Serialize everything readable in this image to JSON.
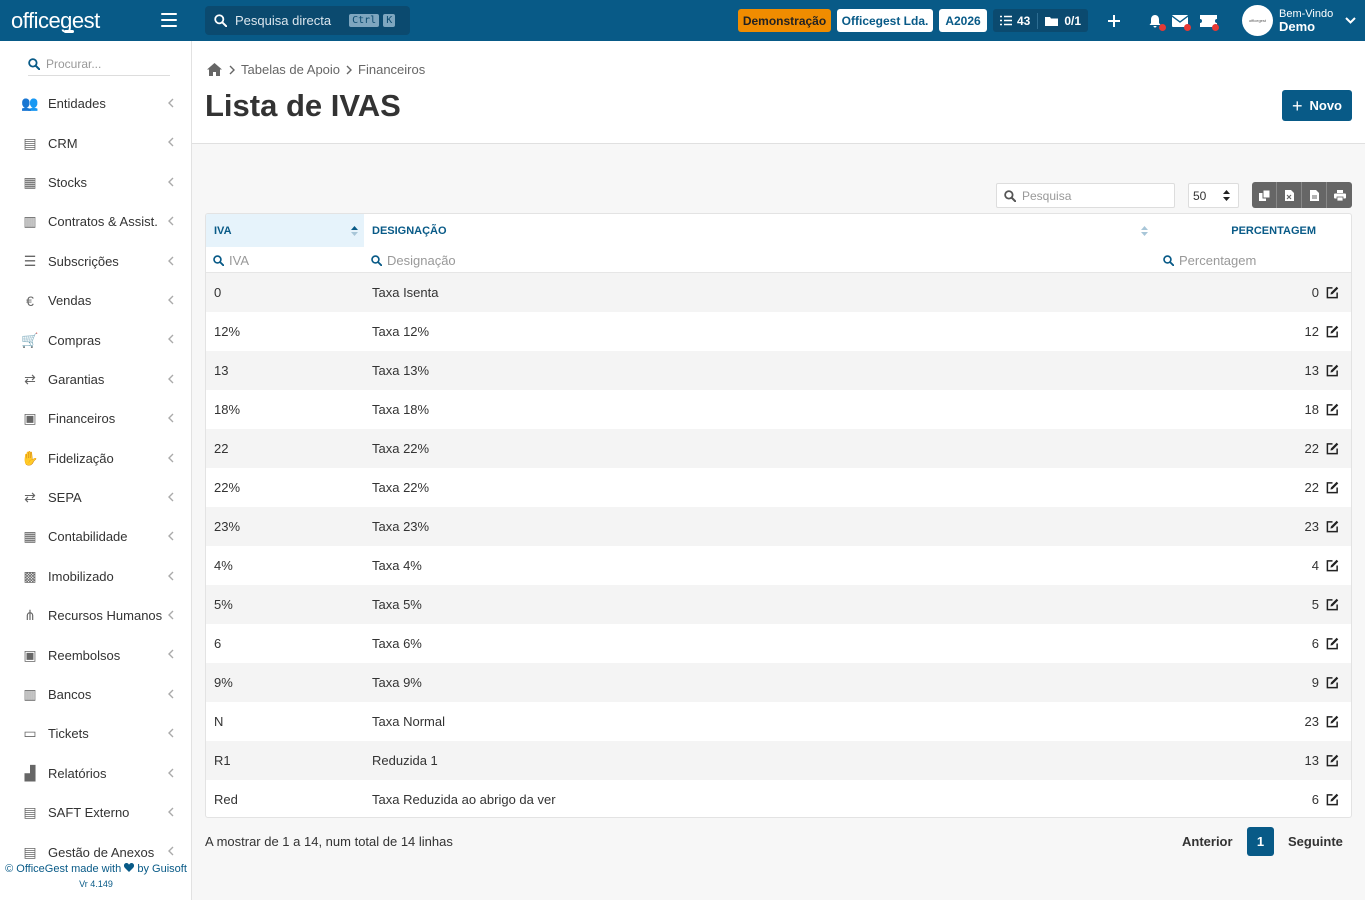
{
  "topbar": {
    "logo": "officegest",
    "search_label": "Pesquisa directa",
    "search_kbd1": "Ctrl",
    "search_kbd2": "K",
    "badge_demo": "Demonstração",
    "badge_company": "Officegest Lda.",
    "badge_year": "A2026",
    "tasks_count": "43",
    "docs_count": "0/1",
    "greeting": "Bem-Vindo",
    "user_name": "Demo",
    "colors": {
      "primary": "#085a87",
      "demo": "#f08c00",
      "alert": "#e53935"
    }
  },
  "sidebar": {
    "search_placeholder": "Procurar...",
    "items": [
      {
        "label": "Entidades",
        "icon": "users-icon"
      },
      {
        "label": "CRM",
        "icon": "book-icon"
      },
      {
        "label": "Stocks",
        "icon": "warehouse-icon"
      },
      {
        "label": "Contratos & Assist.",
        "icon": "contract-icon"
      },
      {
        "label": "Subscrições",
        "icon": "list-icon"
      },
      {
        "label": "Vendas",
        "icon": "euro-icon"
      },
      {
        "label": "Compras",
        "icon": "cart-icon"
      },
      {
        "label": "Garantias",
        "icon": "exchange-icon"
      },
      {
        "label": "Financeiros",
        "icon": "money-icon"
      },
      {
        "label": "Fidelização",
        "icon": "hand-coin-icon"
      },
      {
        "label": "SEPA",
        "icon": "exchange-icon"
      },
      {
        "label": "Contabilidade",
        "icon": "calculator-icon"
      },
      {
        "label": "Imobilizado",
        "icon": "box-icon"
      },
      {
        "label": "Recursos Humanos",
        "icon": "sitemap-icon"
      },
      {
        "label": "Reembolsos",
        "icon": "money-icon"
      },
      {
        "label": "Bancos",
        "icon": "bank-icon"
      },
      {
        "label": "Tickets",
        "icon": "ticket-icon"
      },
      {
        "label": "Relatórios",
        "icon": "chart-icon"
      },
      {
        "label": "SAFT Externo",
        "icon": "file-code-icon"
      },
      {
        "label": "Gestão de Anexos",
        "icon": "file-icon"
      }
    ],
    "footer_line1_a": "© OfficeGest made with",
    "footer_line1_b": "by Guisoft",
    "footer_version": "Vr 4.149"
  },
  "header": {
    "breadcrumb": [
      "Tabelas de Apoio",
      "Financeiros"
    ],
    "title": "Lista de IVAS",
    "new_button": "Novo"
  },
  "table": {
    "search_placeholder": "Pesquisa",
    "page_size": "50",
    "columns": {
      "iva": "IVA",
      "designacao": "DESIGNAÇÃO",
      "percentagem": "PERCENTAGEM"
    },
    "filters": {
      "iva": "IVA",
      "designacao": "Designação",
      "percentagem": "Percentagem"
    },
    "rows": [
      {
        "iva": "0",
        "designacao": "Taxa Isenta",
        "percentagem": "0"
      },
      {
        "iva": "12%",
        "designacao": "Taxa 12%",
        "percentagem": "12"
      },
      {
        "iva": "13",
        "designacao": "Taxa 13%",
        "percentagem": "13"
      },
      {
        "iva": "18%",
        "designacao": "Taxa 18%",
        "percentagem": "18"
      },
      {
        "iva": "22",
        "designacao": "Taxa 22%",
        "percentagem": "22"
      },
      {
        "iva": "22%",
        "designacao": "Taxa 22%",
        "percentagem": "22"
      },
      {
        "iva": "23%",
        "designacao": "Taxa 23%",
        "percentagem": "23"
      },
      {
        "iva": "4%",
        "designacao": "Taxa 4%",
        "percentagem": "4"
      },
      {
        "iva": "5%",
        "designacao": "Taxa 5%",
        "percentagem": "5"
      },
      {
        "iva": "6",
        "designacao": "Taxa 6%",
        "percentagem": "6"
      },
      {
        "iva": "9%",
        "designacao": "Taxa 9%",
        "percentagem": "9"
      },
      {
        "iva": "N",
        "designacao": "Taxa Normal",
        "percentagem": "23"
      },
      {
        "iva": "R1",
        "designacao": "Reduzida 1",
        "percentagem": "13"
      },
      {
        "iva": "Red",
        "designacao": "Taxa Reduzida ao abrigo da ver",
        "percentagem": "6"
      }
    ]
  },
  "pagination": {
    "info": "A mostrar de 1 a 14, num total de 14 linhas",
    "prev": "Anterior",
    "current": "1",
    "next": "Seguinte"
  }
}
